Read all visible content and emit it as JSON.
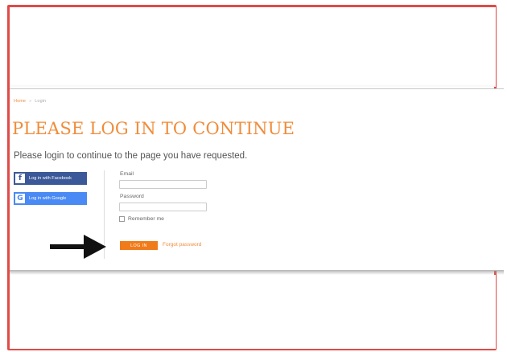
{
  "breadcrumb": {
    "home": "Home",
    "separator": "»",
    "current": "Login"
  },
  "page": {
    "title": "PLEASE LOG IN TO CONTINUE",
    "subtitle": "Please login to continue to the page you have requested."
  },
  "social": {
    "facebook": {
      "icon": "f",
      "label": "Log in with Facebook",
      "color": "#3b5998"
    },
    "google": {
      "icon": "G",
      "label": "Log in with Google",
      "color": "#4a8af4"
    }
  },
  "form": {
    "email_label": "Email",
    "email_value": "",
    "password_label": "Password",
    "password_value": "",
    "remember_label": "Remember me",
    "login_button": "LOG IN",
    "forgot_link": "Forgot password"
  },
  "colors": {
    "accent": "#f08c3a",
    "button": "#f07b1a",
    "frame_border": "#e04a47",
    "arrow": "#111111"
  },
  "icons": {
    "arrow": "right-arrow-icon"
  }
}
